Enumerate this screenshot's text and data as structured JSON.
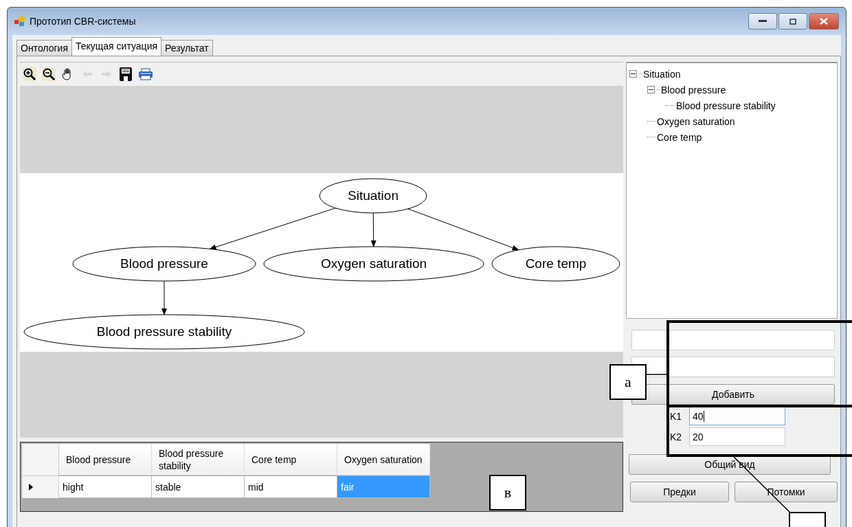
{
  "window": {
    "title": "Прототип CBR-системы"
  },
  "tabs": [
    {
      "label": "Онтология",
      "selected": false
    },
    {
      "label": "Текущая ситуация",
      "selected": true
    },
    {
      "label": "Результат",
      "selected": false
    }
  ],
  "graph": {
    "label": "Situation",
    "children": [
      {
        "label": "Blood pressure",
        "children": [
          {
            "label": "Blood pressure stability"
          }
        ]
      },
      {
        "label": "Oxygen saturation"
      },
      {
        "label": "Core temp"
      }
    ]
  },
  "tree": [
    {
      "label": "Situation",
      "expanded": true,
      "children": [
        {
          "label": "Blood pressure",
          "expanded": true,
          "children": [
            {
              "label": "Blood pressure stability"
            }
          ]
        },
        {
          "label": "Oxygen saturation"
        },
        {
          "label": "Core temp"
        }
      ]
    }
  ],
  "add_button": "Добавить",
  "k_fields": [
    {
      "label": "K1",
      "value": "40",
      "focused": true
    },
    {
      "label": "K2",
      "value": "20",
      "focused": false
    }
  ],
  "overview_button": "Общий вид",
  "nav_buttons": [
    "Предки",
    "Потомки"
  ],
  "table": {
    "columns": [
      "Blood pressure",
      "Blood pressure stability",
      "Core temp",
      "Oxygen saturation"
    ],
    "rows": [
      {
        "current": true,
        "cells": [
          {
            "text": "hight",
            "selected": false
          },
          {
            "text": "stable",
            "selected": false
          },
          {
            "text": "mid",
            "selected": false
          },
          {
            "text": "fair",
            "selected": true
          }
        ]
      }
    ]
  },
  "callouts": [
    "а",
    "в"
  ]
}
